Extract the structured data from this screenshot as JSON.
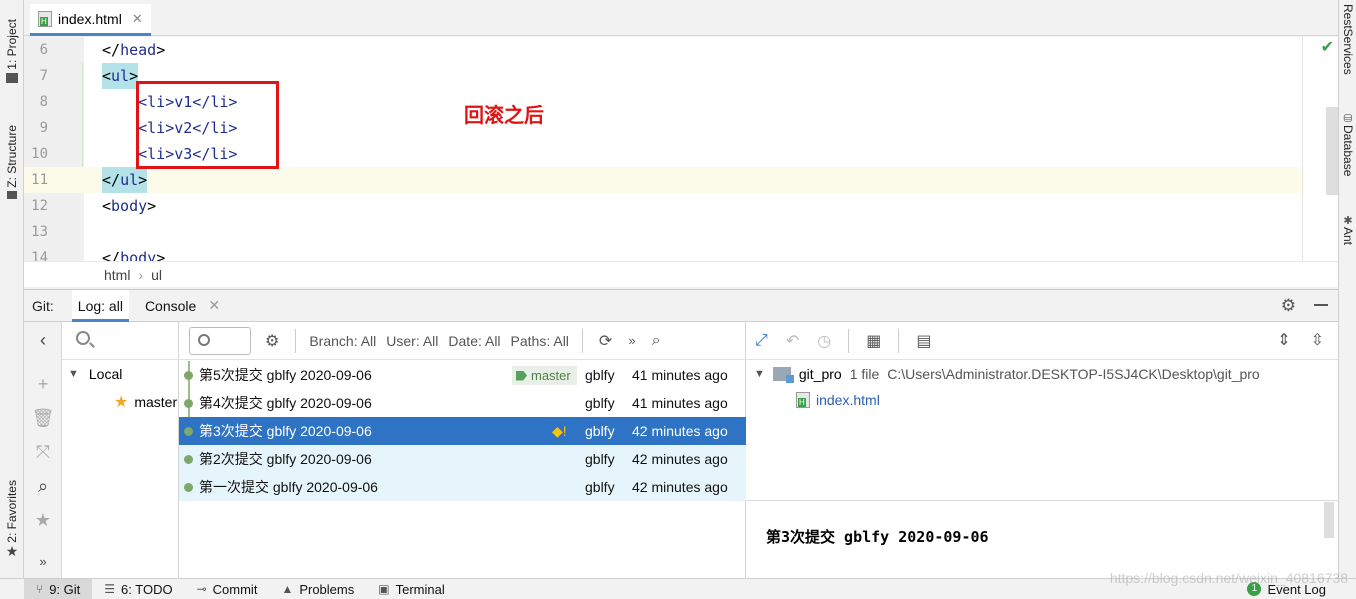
{
  "left_strip": {
    "project": "1: Project",
    "structure": "Z: Structure",
    "favorites": "2: Favorites"
  },
  "right_strip": {
    "rest": "RestServices",
    "database": "Database",
    "ant": "Ant"
  },
  "editor": {
    "tab_name": "index.html",
    "lines": [
      {
        "num": "6",
        "pre": "</",
        "tag": "head",
        "post": ">"
      },
      {
        "num": "7",
        "pre": "<",
        "tag": "ul",
        "post": ">"
      },
      {
        "num": "8",
        "text": "    <li>v1</li>"
      },
      {
        "num": "9",
        "text": "    <li>v2</li>"
      },
      {
        "num": "10",
        "text": "    <li>v3</li>"
      },
      {
        "num": "11",
        "pre": "</",
        "tag": "ul",
        "post": ">"
      },
      {
        "num": "12",
        "pre": "<",
        "tag": "body",
        "post": ">"
      },
      {
        "num": "13",
        "text": ""
      },
      {
        "num": "14",
        "pre": "</",
        "tag": "body",
        "post": ">"
      }
    ],
    "annotation": "回滚之后",
    "breadcrumb": [
      "html",
      "ul"
    ]
  },
  "git": {
    "label": "Git:",
    "tab_log": "Log: all",
    "tab_console": "Console",
    "branches": {
      "local": "Local",
      "master": "master"
    },
    "filters": {
      "branch": "Branch: All",
      "user": "User: All",
      "date": "Date: All",
      "paths": "Paths: All"
    },
    "commits": [
      {
        "msg": "第5次提交 gblfy 2020-09-06",
        "author": "gblfy",
        "time": "41 minutes ago",
        "tag": "master"
      },
      {
        "msg": "第4次提交 gblfy 2020-09-06",
        "author": "gblfy",
        "time": "41 minutes ago"
      },
      {
        "msg": "第3次提交 gblfy 2020-09-06",
        "author": "gblfy",
        "time": "42 minutes ago"
      },
      {
        "msg": "第2次提交 gblfy 2020-09-06",
        "author": "gblfy",
        "time": "42 minutes ago"
      },
      {
        "msg": "第一次提交 gblfy 2020-09-06",
        "author": "gblfy",
        "time": "42 minutes ago"
      }
    ],
    "details": {
      "repo": "git_pro",
      "file_count": "1 file",
      "path": "C:\\Users\\Administrator.DESKTOP-I5SJ4CK\\Desktop\\git_pro",
      "file": "index.html",
      "commit_title": "第3次提交 gblfy 2020-09-06"
    }
  },
  "statusbar": {
    "git": "9: Git",
    "todo": "6: TODO",
    "commit": "Commit",
    "problems": "Problems",
    "terminal": "Terminal",
    "event_log": "Event Log",
    "event_count": "1"
  },
  "watermark": "https://blog.csdn.net/weixin_40816738"
}
